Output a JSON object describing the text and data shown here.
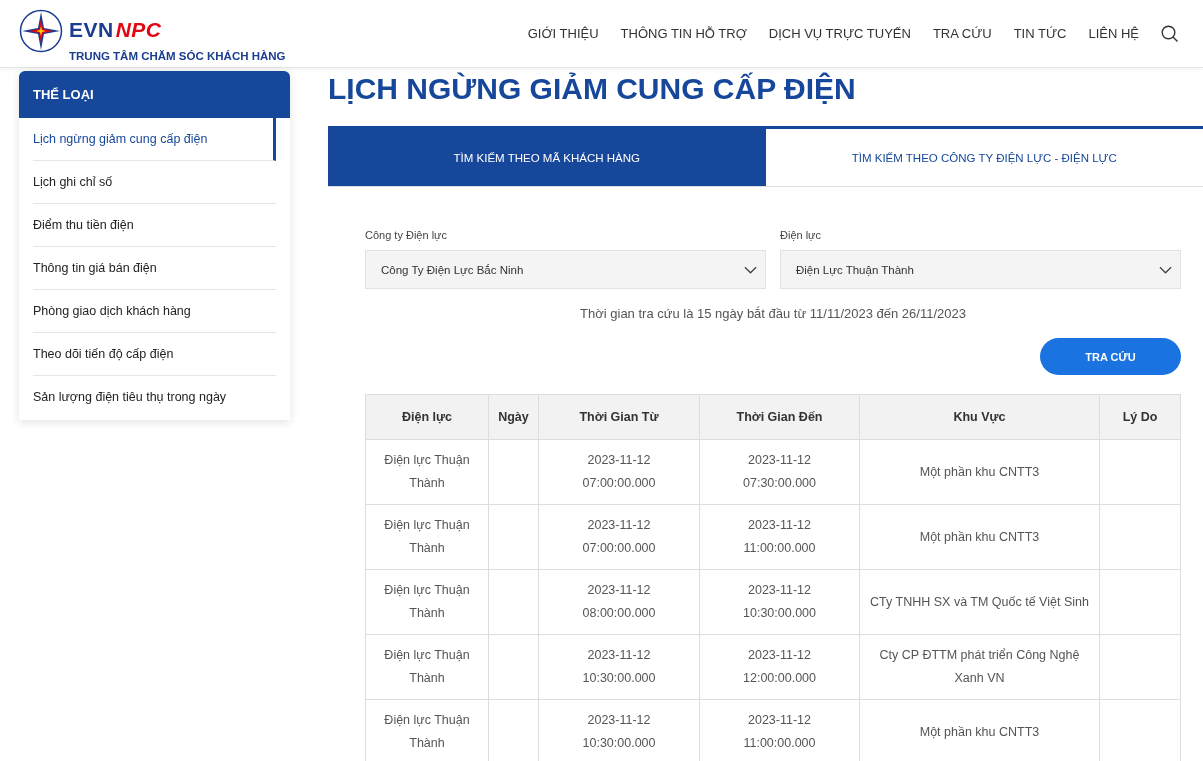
{
  "header": {
    "logo_text": "EVN",
    "logo_accent": "NPC",
    "logo_subtitle": "TRUNG TÂM CHĂM SÓC KHÁCH HÀNG",
    "nav": [
      "GIỚI THIỆU",
      "THÔNG TIN HỖ TRỢ",
      "DỊCH VỤ TRỰC TUYẾN",
      "TRA CỨU",
      "TIN TỨC",
      "LIÊN HỆ"
    ]
  },
  "sidebar": {
    "title": "THỂ LOẠI",
    "items": [
      {
        "label": "Lịch ngừng giảm cung cấp điện",
        "selected": true
      },
      {
        "label": "Lịch ghi chỉ số",
        "selected": false
      },
      {
        "label": "Điểm thu tiền điện",
        "selected": false
      },
      {
        "label": "Thông tin giá bán điện",
        "selected": false
      },
      {
        "label": "Phòng giao dịch khách hàng",
        "selected": false
      },
      {
        "label": "Theo dõi tiến độ cấp điện",
        "selected": false
      },
      {
        "label": "Sản lượng điện tiêu thụ trong ngày",
        "selected": false
      }
    ]
  },
  "page_title": "LỊCH NGỪNG GIẢM CUNG CẤP ĐIỆN",
  "tabs": [
    {
      "label": "TÌM KIẾM THEO MÃ KHÁCH HÀNG",
      "selected": true
    },
    {
      "label": "TÌM KIẾM THEO CÔNG TY ĐIỆN LỰC - ĐIỆN LỰC",
      "selected": false
    }
  ],
  "form": {
    "fields": [
      {
        "label": "Công ty Điện lực",
        "value": "Công Ty Điện Lực Bắc Ninh"
      },
      {
        "label": "Điện lực",
        "value": "Điện Lực Thuận Thành"
      }
    ],
    "note": "Thời gian tra cứu là 15 ngày bắt đầu từ 11/11/2023 đến 26/11/2023",
    "button": "TRA CỨU"
  },
  "table": {
    "columns": [
      "Điện lực",
      "Ngày",
      "Thời Gian Từ",
      "Thời Gian Đến",
      "Khu Vực",
      "Lý Do"
    ],
    "rows": [
      [
        "Điện lực Thuận Thành",
        "",
        "2023-11-12\n07:00:00.000",
        "2023-11-12\n07:30:00.000",
        "Một phần khu CNTT3",
        ""
      ],
      [
        "Điện lực Thuận Thành",
        "",
        "2023-11-12\n07:00:00.000",
        "2023-11-12\n11:00:00.000",
        "Một phần khu CNTT3",
        ""
      ],
      [
        "Điện lực Thuận Thành",
        "",
        "2023-11-12\n08:00:00.000",
        "2023-11-12\n10:30:00.000",
        "CTy TNHH SX và TM Quốc tế Việt Sinh",
        ""
      ],
      [
        "Điện lực Thuận Thành",
        "",
        "2023-11-12\n10:30:00.000",
        "2023-11-12\n12:00:00.000",
        "Cty CP ĐTTM phát triển Công Nghệ Xanh VN",
        ""
      ],
      [
        "Điện lực Thuận Thành",
        "",
        "2023-11-12\n10:30:00.000",
        "2023-11-12\n11:00:00.000",
        "Một phần khu CNTT3",
        ""
      ]
    ]
  }
}
